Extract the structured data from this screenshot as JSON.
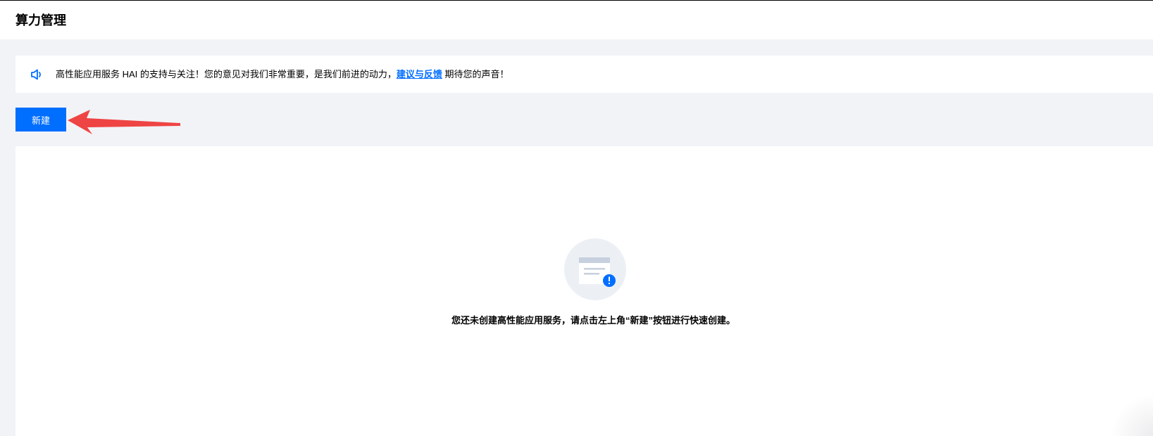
{
  "header": {
    "title": "算力管理"
  },
  "notice": {
    "icon": "speaker-icon",
    "text_before": "高性能应用服务 HAI 的支持与关注！您的意见对我们非常重要，是我们前进的动力，",
    "link_label": "建议与反馈",
    "text_after": " 期待您的声音！"
  },
  "toolbar": {
    "create_label": "新建"
  },
  "empty_state": {
    "icon": "empty-document-icon",
    "message": "您还未创建高性能应用服务，请点击左上角“新建”按钮进行快速创建。"
  },
  "colors": {
    "accent": "#006eff",
    "annotation_arrow": "#ef4444",
    "page_background": "#f2f3f7"
  }
}
